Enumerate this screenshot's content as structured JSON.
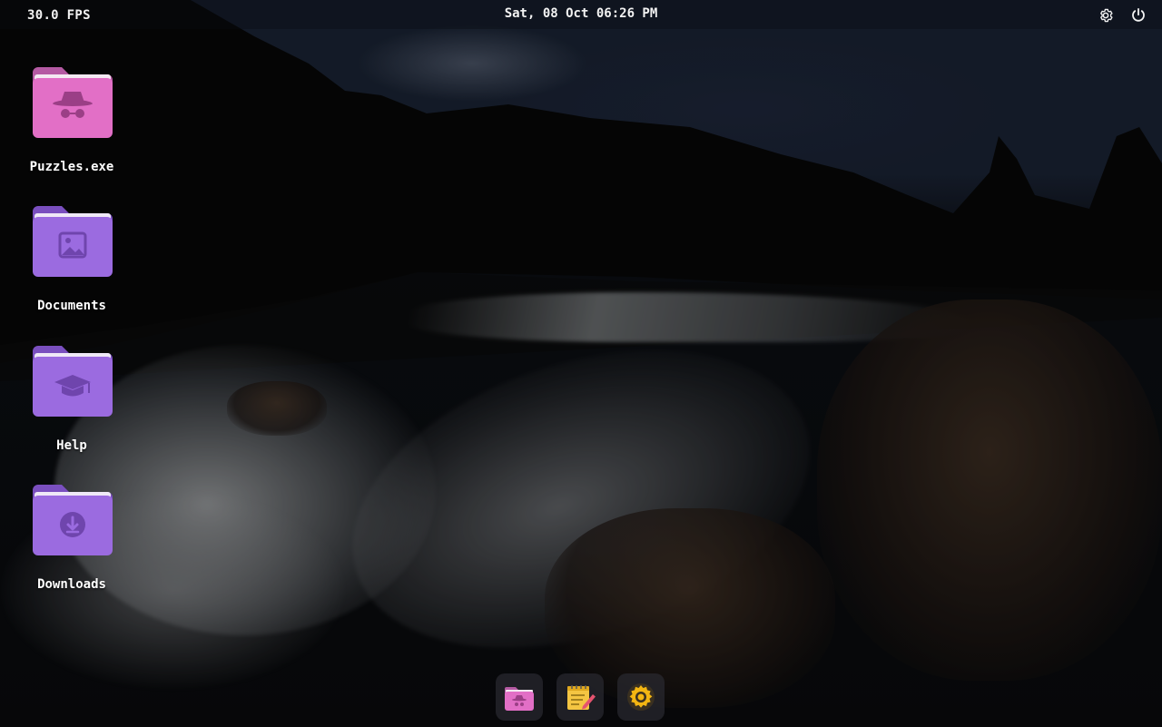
{
  "topbar": {
    "fps": "30.0 FPS",
    "datetime": "Sat, 08 Oct 06:26 PM",
    "settings_icon": "gear-icon",
    "power_icon": "power-icon"
  },
  "desktop": {
    "items": [
      {
        "label": "Puzzles.exe",
        "icon": "incognito-folder-icon",
        "color": "#e26fc6"
      },
      {
        "label": "Documents",
        "icon": "image-folder-icon",
        "color": "#9b6be0"
      },
      {
        "label": "Help",
        "icon": "graduation-cap-folder-icon",
        "color": "#9b6be0"
      },
      {
        "label": "Downloads",
        "icon": "download-folder-icon",
        "color": "#9b6be0"
      }
    ]
  },
  "dock": {
    "items": [
      {
        "icon": "incognito-folder-icon",
        "color": "#e26fc6"
      },
      {
        "icon": "notes-icon",
        "color": "#f4c542"
      },
      {
        "icon": "settings-gear-icon",
        "color": "#f3b512"
      }
    ]
  },
  "colors": {
    "folder_pink": "#e26fc6",
    "folder_purple": "#9b6be0",
    "text": "#ffffff"
  }
}
